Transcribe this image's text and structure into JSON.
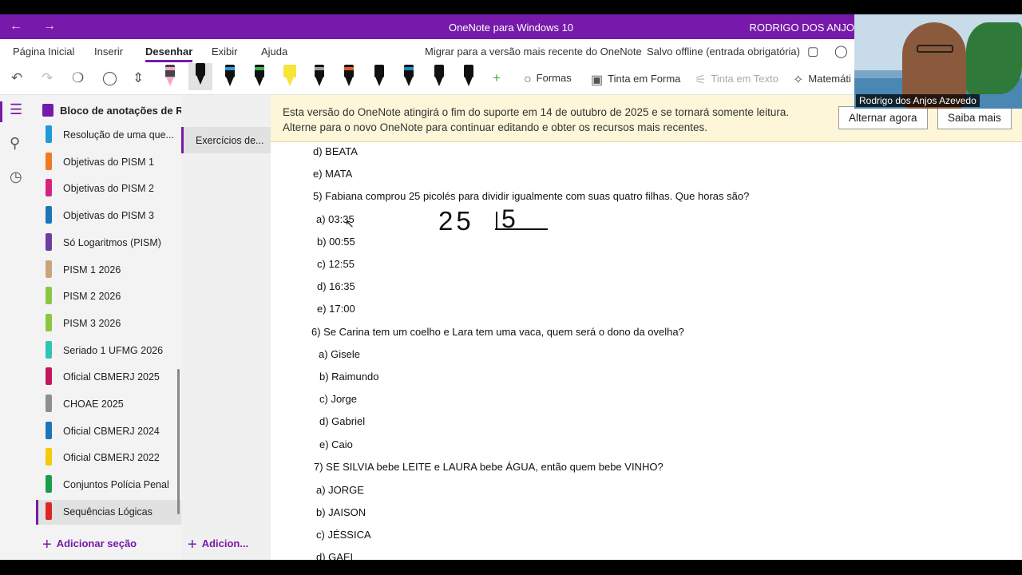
{
  "titlebar": {
    "back_icon": "arrow-left-icon",
    "forward_icon": "arrow-right-icon",
    "title": "OneNote para Windows 10",
    "user": "RODRIGO DOS ANJO"
  },
  "ribbon": {
    "tabs": [
      "Página Inicial",
      "Inserir",
      "Desenhar",
      "Exibir",
      "Ajuda"
    ],
    "active_tab": "Desenhar",
    "migrate_link": "Migrar para a versão mais recente do OneNote",
    "save_status": "Salvo offline (entrada obrigatória)"
  },
  "toolbar": {
    "formas": "Formas",
    "tinta_em_forma": "Tinta em Forma",
    "tinta_em_texto": "Tinta em Texto",
    "matematica": "Matemáti",
    "pen_colors": [
      "#f4a6c8",
      "#111111",
      "#2a9be0",
      "#37b34a",
      "#f5e535",
      "#9aa0a6",
      "#e85a2a",
      "#111111",
      "#1a8fc9",
      "#111111",
      "#111111"
    ]
  },
  "notebook": {
    "name": "Bloco de anotações de RODRIGO",
    "sections": [
      {
        "label": "Resolução de uma que...",
        "color": "#1e9bd7"
      },
      {
        "label": "Objetivas do PISM 1",
        "color": "#f07a24"
      },
      {
        "label": "Objetivas do PISM 2",
        "color": "#d6237e"
      },
      {
        "label": "Objetivas do PISM 3",
        "color": "#1b75bb"
      },
      {
        "label": "Só Logaritmos (PISM)",
        "color": "#6b3fa0"
      },
      {
        "label": "PISM 1 2026",
        "color": "#c9a57d"
      },
      {
        "label": "PISM 2 2026",
        "color": "#8cc63f"
      },
      {
        "label": "PISM 3 2026",
        "color": "#8cc63f"
      },
      {
        "label": "Seriado 1 UFMG 2026",
        "color": "#2ec4b6"
      },
      {
        "label": "Oficial CBMERJ 2025",
        "color": "#c2185b"
      },
      {
        "label": "CHOAE 2025",
        "color": "#8e8e8e"
      },
      {
        "label": "Oficial CBMERJ 2024",
        "color": "#1b75bb"
      },
      {
        "label": "Oficial CBMERJ 2022",
        "color": "#f6c90e"
      },
      {
        "label": "Conjuntos Polícia Penal",
        "color": "#1a9c4a"
      },
      {
        "label": "Sequências Lógicas",
        "color": "#e02424"
      }
    ],
    "selected_section": "Sequências Lógicas",
    "add_section": "Adicionar seção"
  },
  "pages": {
    "items": [
      "Exercícios de..."
    ],
    "add_page": "Adicion..."
  },
  "banner": {
    "line1": "Esta versão do OneNote atingirá o fim do suporte em 14 de outubro de 2025 e se tornará somente leitura.",
    "line2": "Alterne para o novo OneNote para continuar editando e obter os recursos mais recentes.",
    "switch_button": "Alternar agora",
    "learn_button": "Saiba mais"
  },
  "note": {
    "lines": [
      "d)    BEATA",
      "e)    MATA",
      "5)    Fabiana comprou 25 picolés para dividir igualmente com suas quatro filhas. Que horas são?",
      "a) 03:35",
      "b) 00:55",
      "c) 12:55",
      "d) 16:35",
      "e) 17:00",
      "6) Se Carina tem um coelho e Lara tem uma vaca, quem será o dono da ovelha?",
      "a) Gisele",
      "b) Raimundo",
      "c) Jorge",
      "d) Gabriel",
      "e) Caio",
      "7) SE SILVIA bebe LEITE e LAURA bebe ÁGUA, então quem bebe VINHO?",
      "a) JORGE",
      "b) JAISON",
      "c) JÉSSICA",
      "d) GAEL"
    ],
    "ink": {
      "dividend": "25",
      "divisor": "5"
    }
  },
  "webcam": {
    "caption": "Rodrigo dos Anjos Azevedo"
  }
}
